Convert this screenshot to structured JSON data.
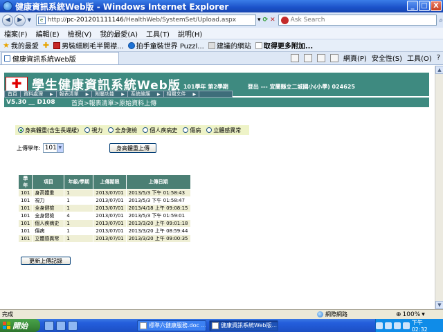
{
  "window": {
    "title": "健康資訊系統Web版 - Windows Internet Explorer",
    "controls": {
      "minimize": "_",
      "maximize": "□",
      "close": "X"
    }
  },
  "address": {
    "url_prefix": "http://",
    "url_host": "pc-201201111146",
    "url_path": "/HealthWeb/SystemSet/Upload.aspx",
    "search_placeholder": "Ask Search"
  },
  "menu": [
    "檔案(F)",
    "編輯(E)",
    "檢視(V)",
    "我的最愛(A)",
    "工具(T)",
    "說明(H)"
  ],
  "favorites": {
    "label": "我的最愛",
    "items": [
      {
        "label": "男裝細刷毛半開襟...",
        "icon": "red-tag-icon"
      },
      {
        "label": "拍手童裝世界 Puzzl...",
        "icon": "blue-circle-icon"
      },
      {
        "label": "建議的網站",
        "icon": "suggested-icon"
      },
      {
        "label": "取得更多附加...",
        "icon": "addons-icon"
      }
    ]
  },
  "tab": {
    "label": "健康資訊系統Web版"
  },
  "commandbar": {
    "page": "網頁(P)",
    "safety": "安全性(S)",
    "tools": "工具(O)"
  },
  "app": {
    "title_cn": "學生健康資訊系統",
    "title_web": "Web版",
    "semester": "101學年 第2學期",
    "login": "登出 ---   宜蘭縣立二城國小(小學) 024625",
    "nav": [
      "首頁",
      "資料處理",
      "報表清單",
      "附屬功能",
      "系統維護",
      "相關文件"
    ],
    "version": "V5.30 __ D108",
    "breadcrumb": "首頁>報表清單>原始資料上傳",
    "radios": [
      {
        "label": "身高體重(含生長遲緩)",
        "checked": true
      },
      {
        "label": "視力",
        "checked": false
      },
      {
        "label": "全身健檢",
        "checked": false
      },
      {
        "label": "個人疾病史",
        "checked": false
      },
      {
        "label": "傷病",
        "checked": false
      },
      {
        "label": "立體感異常",
        "checked": false
      }
    ],
    "year_label": "上傳學年:",
    "year_value": "101",
    "upload_button": "身高體重上傳",
    "table": {
      "headers": [
        "學年",
        "項目",
        "年級/學期",
        "上傳期限",
        "上傳日期"
      ],
      "rows": [
        [
          "101",
          "身高體重",
          "1",
          "2013/07/01",
          "2013/5/3 下午 01:58:43"
        ],
        [
          "101",
          "視力",
          "1",
          "2013/07/01",
          "2013/5/3 下午 01:58:47"
        ],
        [
          "101",
          "全身健檢",
          "1",
          "2013/07/01",
          "2013/4/18 上午 09:08:15"
        ],
        [
          "101",
          "全身健檢",
          "4",
          "2013/07/01",
          "2013/5/3 下午 01:59:01"
        ],
        [
          "101",
          "個人疾病史",
          "1",
          "2013/07/01",
          "2013/3/20 上午 09:01:18"
        ],
        [
          "101",
          "傷病",
          "1",
          "2013/07/01",
          "2013/3/20 上午 08:59:44"
        ],
        [
          "101",
          "立體感異常",
          "1",
          "2013/07/01",
          "2013/3/20 上午 09:00:35"
        ]
      ]
    },
    "refresh_button": "更新上傳記錄"
  },
  "status": {
    "text": "完成",
    "zone": "網際網路",
    "zoom": "100%"
  },
  "taskbar": {
    "start": "開始",
    "tasks": [
      {
        "label": "標準六健康服務.doc ...",
        "active": false
      },
      {
        "label": "健康資訊系統Web版...",
        "active": true
      }
    ],
    "clock": "下午 02:32"
  },
  "colors": {
    "brand": "#3e8a80",
    "nav": "#3e6d7a",
    "table_header": "#4b7f74",
    "row_alt": "#efefd5",
    "radio_bg": "#eef3c7"
  }
}
